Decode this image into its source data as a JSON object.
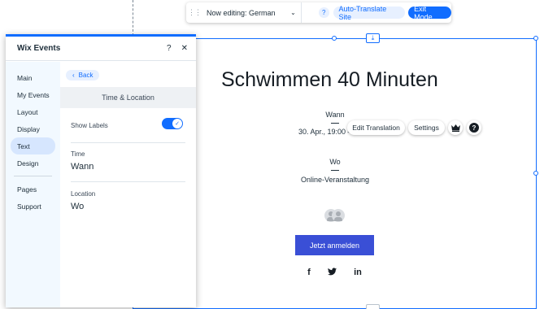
{
  "toolbar": {
    "drag_icon": "drag-handle-icon",
    "language_label": "Now editing: German",
    "help_label": "?",
    "auto_translate_label": "Auto-Translate Site",
    "exit_mode_label": "Exit Mode"
  },
  "panel": {
    "title": "Wix Events",
    "help_label": "?",
    "close_label": "✕",
    "nav_items": [
      "Main",
      "My Events",
      "Layout",
      "Display",
      "Text",
      "Design"
    ],
    "nav_items_secondary": [
      "Pages",
      "Support"
    ],
    "active_nav": "Text",
    "back_label": "Back",
    "section_title": "Time & Location",
    "show_labels_label": "Show Labels",
    "show_labels_on": true,
    "time_label": "Time",
    "time_value": "Wann",
    "location_label": "Location",
    "location_value": "Wo"
  },
  "event": {
    "title": "Schwimmen 40 Minuten",
    "time_label": "Wann",
    "date_text": "30. Apr., 19:00 –",
    "location_label": "Wo",
    "location_text": "Online-Veranstaltung",
    "rsvp_label": "Jetzt anmelden",
    "social_icons": [
      "facebook-icon",
      "twitter-icon",
      "linkedin-icon"
    ],
    "social_labels": [
      "f",
      "🐦",
      "in"
    ]
  },
  "floating_toolbar": {
    "edit_translation_label": "Edit Translation",
    "settings_label": "Settings",
    "help_label": "?"
  },
  "colors": {
    "accent": "#116dff",
    "rsvp_button": "#3a4fd6",
    "nav_bg": "#f2f9ff"
  }
}
